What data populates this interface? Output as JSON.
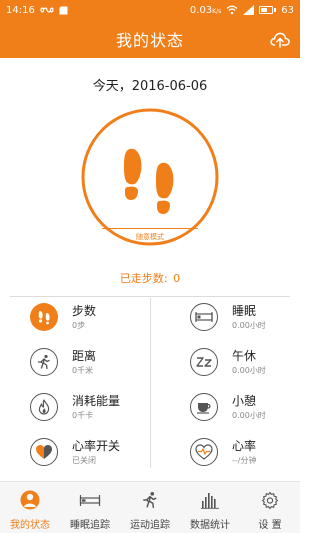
{
  "status_bar": {
    "time": "14:16",
    "data_rate": "0.03",
    "data_rate_unit": "K/s",
    "battery": "63",
    "battery_level": 0.63,
    "icons": [
      "infinity-icon",
      "sd-card-icon",
      "wifi-icon",
      "signal-icon",
      "battery-icon"
    ]
  },
  "header": {
    "title": "我的状态",
    "action_icon": "cloud-upload-icon"
  },
  "main": {
    "date_text": "今天，2016-06-06",
    "mode_label": "随意模式",
    "steps_walked_label": "已走步数:",
    "steps_walked_value": "0"
  },
  "metrics": [
    {
      "label": "步数",
      "value": "0步",
      "icon": "footprints-icon"
    },
    {
      "label": "睡眠",
      "value": "0.00小时",
      "icon": "bed-icon"
    },
    {
      "label": "距离",
      "value": "0千米",
      "icon": "running-icon"
    },
    {
      "label": "午休",
      "value": "0.00小时",
      "icon": "nap-zz-icon"
    },
    {
      "label": "消耗能量",
      "value": "0千卡",
      "icon": "flame-icon"
    },
    {
      "label": "小憩",
      "value": "0.00小时",
      "icon": "coffee-cup-icon"
    },
    {
      "label": "心率开关",
      "value": "已关闭",
      "icon": "heart-half-icon"
    },
    {
      "label": "心率",
      "value": "--/分钟",
      "icon": "heart-pulse-icon"
    }
  ],
  "tabs": [
    {
      "label": "我的状态",
      "icon": "person-icon",
      "active": true
    },
    {
      "label": "睡眠追踪",
      "icon": "bed-icon",
      "active": false
    },
    {
      "label": "运动追踪",
      "icon": "running-icon",
      "active": false
    },
    {
      "label": "数据统计",
      "icon": "bar-chart-icon",
      "active": false
    },
    {
      "label": "设 置",
      "icon": "gear-icon",
      "active": false
    }
  ],
  "colors": {
    "accent": "#f07f1a",
    "text": "#222222",
    "muted": "#888888",
    "divider": "#dcdcdc"
  }
}
